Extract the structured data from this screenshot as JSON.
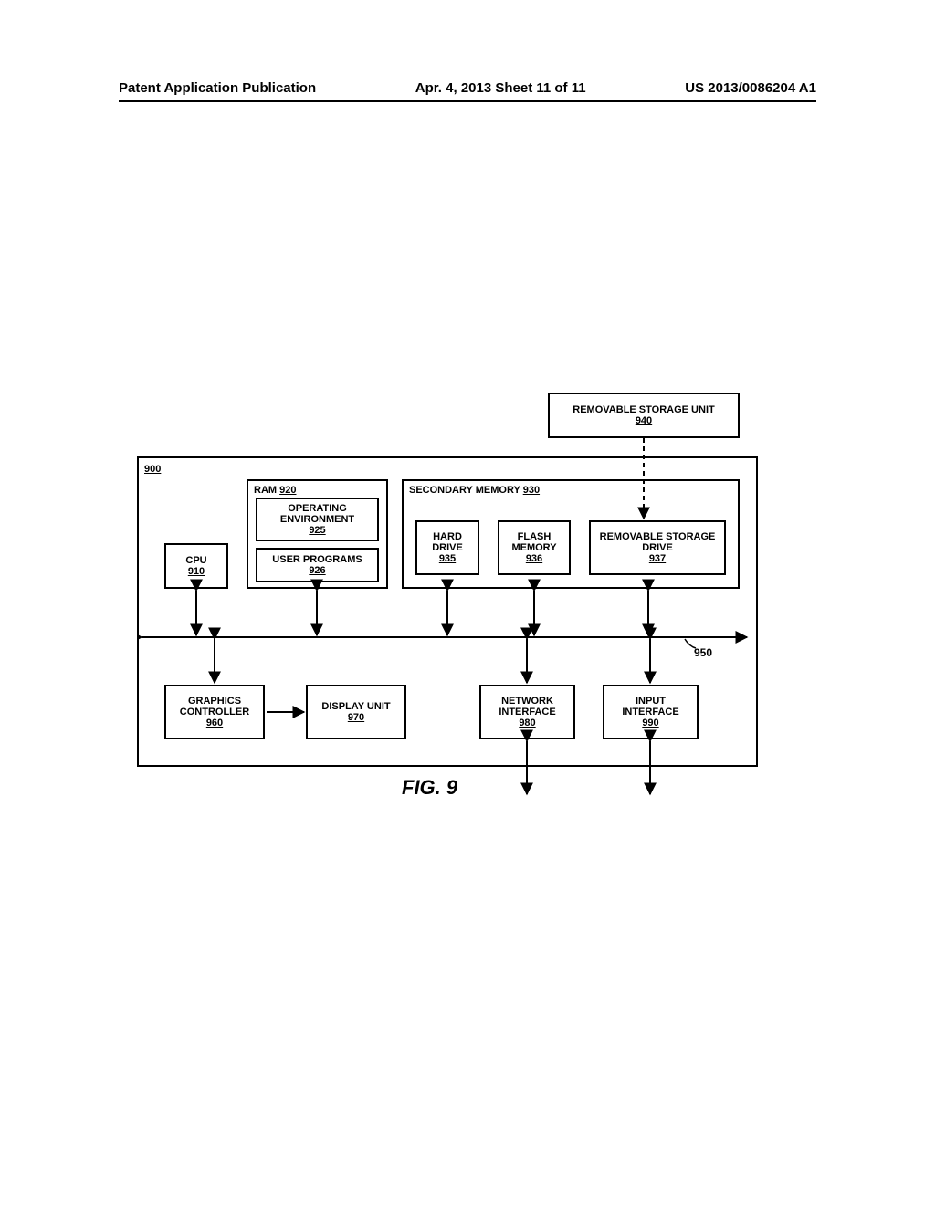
{
  "header": {
    "left": "Patent Application Publication",
    "middle": "Apr. 4, 2013  Sheet 11 of 11",
    "right": "US 2013/0086204 A1"
  },
  "figure_caption": "FIG. 9",
  "system_ref": "900",
  "bus_ref": "950",
  "blocks": {
    "removable_storage_unit": {
      "label": "REMOVABLE STORAGE UNIT",
      "num": "940"
    },
    "ram": {
      "label": "RAM",
      "num": "920"
    },
    "operating_environment": {
      "label": "OPERATING ENVIRONMENT",
      "num": "925"
    },
    "user_programs": {
      "label": "USER PROGRAMS",
      "num": "926"
    },
    "secondary_memory": {
      "label": "SECONDARY MEMORY",
      "num": "930"
    },
    "hard_drive": {
      "label": "HARD DRIVE",
      "num": "935"
    },
    "flash_memory": {
      "label": "FLASH MEMORY",
      "num": "936"
    },
    "removable_storage_drive": {
      "label": "REMOVABLE STORAGE DRIVE",
      "num": "937"
    },
    "cpu": {
      "label": "CPU",
      "num": "910"
    },
    "graphics_controller": {
      "label": "GRAPHICS CONTROLLER",
      "num": "960"
    },
    "display_unit": {
      "label": "DISPLAY UNIT",
      "num": "970"
    },
    "network_interface": {
      "label": "NETWORK INTERFACE",
      "num": "980"
    },
    "input_interface": {
      "label": "INPUT INTERFACE",
      "num": "990"
    }
  }
}
